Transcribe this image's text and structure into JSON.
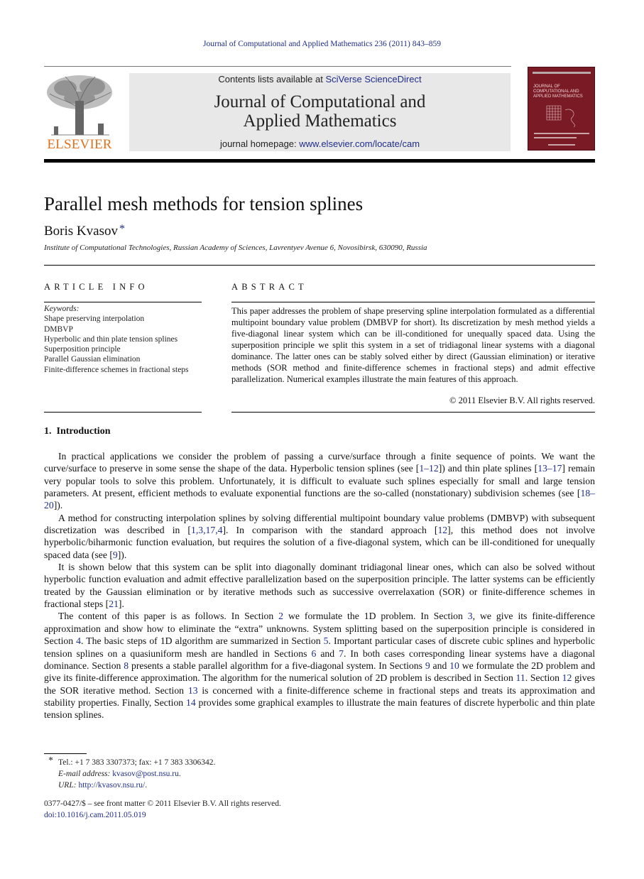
{
  "running_head": "Journal of Computational and Applied Mathematics 236 (2011) 843–859",
  "masthead": {
    "publisher": "ELSEVIER",
    "contents_prefix": "Contents lists available at ",
    "contents_link": "SciVerse ScienceDirect",
    "journal_name": "Journal of Computational and Applied Mathematics",
    "homepage_prefix": "journal homepage: ",
    "homepage_link": "www.elsevier.com/locate/cam",
    "cover_title": "JOURNAL OF COMPUTATIONAL AND APPLIED MATHEMATICS",
    "cover_color": "#7a1a24",
    "logo_color": "#e2711d"
  },
  "article": {
    "title": "Parallel mesh methods for tension splines",
    "author": "Boris Kvasov",
    "author_mark": "*",
    "affiliation": "Institute of Computational Technologies, Russian Academy of Sciences, Lavrentyev Avenue 6, Novosibirsk, 630090, Russia"
  },
  "article_info": {
    "heading": "ARTICLE INFO",
    "keywords_label": "Keywords:",
    "keywords": [
      "Shape preserving interpolation",
      "DMBVP",
      "Hyperbolic and thin plate tension splines",
      "Superposition principle",
      "Parallel Gaussian elimination",
      "Finite-difference schemes in fractional steps"
    ]
  },
  "abstract": {
    "heading": "ABSTRACT",
    "text": "This paper addresses the problem of shape preserving spline interpolation formulated as a differential multipoint boundary value problem (DMBVP for short). Its discretization by mesh method yields a five-diagonal linear system which can be ill-conditioned for unequally spaced data. Using the superposition principle we split this system in a set of tridiagonal linear systems with a diagonal dominance. The latter ones can be stably solved either by direct (Gaussian elimination) or iterative methods (SOR method and finite-difference schemes in fractional steps) and admit effective parallelization. Numerical examples illustrate the main features of this approach.",
    "copyright": "© 2011 Elsevier B.V. All rights reserved."
  },
  "section1": {
    "number": "1.",
    "title": "Introduction",
    "paragraphs": [
      [
        {
          "t": "In practical applications we consider the problem of passing a curve/surface through a finite sequence of points. We want the curve/surface to preserve in some sense the shape of the data. Hyperbolic tension splines (see ["
        },
        {
          "t": "1–12",
          "link": true
        },
        {
          "t": "]) and thin plate splines ["
        },
        {
          "t": "13–17",
          "link": true
        },
        {
          "t": "] remain very popular tools to solve this problem. Unfortunately, it is difficult to evaluate such splines especially for small and large tension parameters. At present, efficient methods to evaluate exponential functions are the so-called (nonstationary) subdivision schemes (see ["
        },
        {
          "t": "18–20",
          "link": true
        },
        {
          "t": "])."
        }
      ],
      [
        {
          "t": "A method for constructing interpolation splines by solving differential multipoint boundary value problems (DMBVP) with subsequent discretization was described in ["
        },
        {
          "t": "1,3,17,4",
          "link": true
        },
        {
          "t": "]. In comparison with the standard approach ["
        },
        {
          "t": "12",
          "link": true
        },
        {
          "t": "], this method does not involve hyperbolic/biharmonic function evaluation, but requires the solution of a five-diagonal system, which can be ill-conditioned for unequally spaced data (see ["
        },
        {
          "t": "9",
          "link": true
        },
        {
          "t": "])."
        }
      ],
      [
        {
          "t": "It is shown below that this system can be split into diagonally dominant tridiagonal linear ones, which can also be solved without hyperbolic function evaluation and admit effective parallelization based on the superposition principle. The latter systems can be efficiently treated by the Gaussian elimination or by iterative methods such as successive overrelaxation (SOR) or finite-difference schemes in fractional steps ["
        },
        {
          "t": "21",
          "link": true
        },
        {
          "t": "]."
        }
      ],
      [
        {
          "t": "The content of this paper is as follows. In Section "
        },
        {
          "t": "2",
          "link": true
        },
        {
          "t": " we formulate the 1D problem. In Section "
        },
        {
          "t": "3",
          "link": true
        },
        {
          "t": ", we give its finite-difference approximation and show how to eliminate the “extra” unknowns. System splitting based on the superposition principle is considered in Section "
        },
        {
          "t": "4",
          "link": true
        },
        {
          "t": ". The basic steps of 1D algorithm are summarized in Section "
        },
        {
          "t": "5",
          "link": true
        },
        {
          "t": ". Important particular cases of discrete cubic splines and hyperbolic tension splines on a quasiuniform mesh are handled in Sections "
        },
        {
          "t": "6",
          "link": true
        },
        {
          "t": " and "
        },
        {
          "t": "7",
          "link": true
        },
        {
          "t": ". In both cases corresponding linear systems have a diagonal dominance. Section "
        },
        {
          "t": "8",
          "link": true
        },
        {
          "t": " presents a stable parallel algorithm for a five-diagonal system. In Sections "
        },
        {
          "t": "9",
          "link": true
        },
        {
          "t": " and "
        },
        {
          "t": "10",
          "link": true
        },
        {
          "t": " we formulate the 2D problem and give its finite-difference approximation. The algorithm for the numerical solution of 2D problem is described in Section "
        },
        {
          "t": "11",
          "link": true
        },
        {
          "t": ". Section "
        },
        {
          "t": "12",
          "link": true
        },
        {
          "t": " gives the SOR iterative method. Section "
        },
        {
          "t": "13",
          "link": true
        },
        {
          "t": " is concerned with a finite-difference scheme in fractional steps and treats its approximation and stability properties. Finally, Section "
        },
        {
          "t": "14",
          "link": true
        },
        {
          "t": " provides some graphical examples to illustrate the main features of discrete hyperbolic and thin plate tension splines."
        }
      ]
    ]
  },
  "footnotes": {
    "mark": "*",
    "tel": "Tel.: +1 7 383 3307373; fax: +1 7 383 3306342.",
    "email_label": "E-mail address:",
    "email": "kvasov@post.nsu.ru",
    "url_label": "URL:",
    "url": "http://kvasov.nsu.ru/"
  },
  "front_matter": {
    "issn_line": "0377-0427/$ – see front matter © 2011 Elsevier B.V. All rights reserved.",
    "doi": "doi:10.1016/j.cam.2011.05.019"
  }
}
